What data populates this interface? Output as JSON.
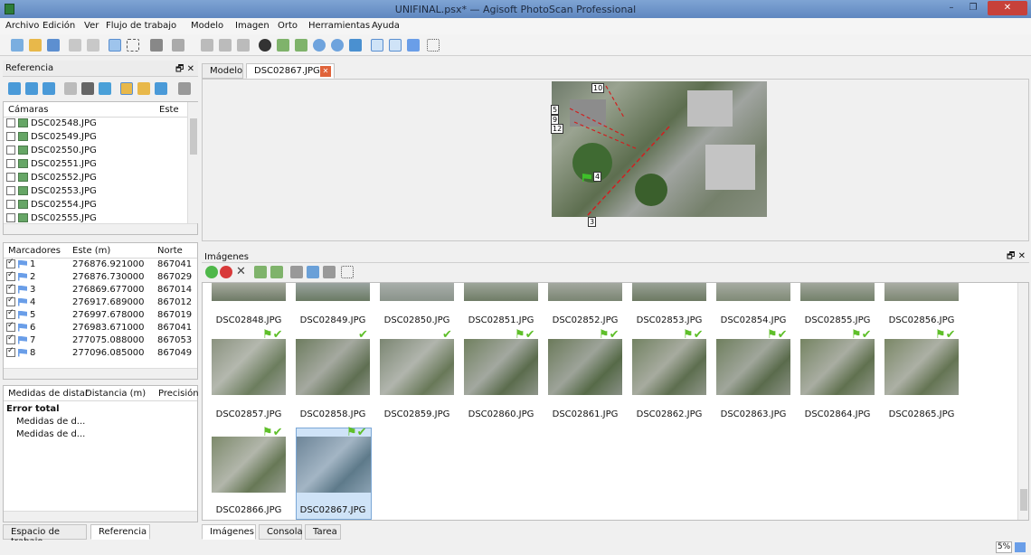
{
  "window": {
    "title": "UNIFINAL.psx* — Agisoft PhotoScan Professional",
    "min": "–",
    "max": "❐",
    "close": "✕"
  },
  "menu": [
    "Archivo",
    "Edición",
    "Ver",
    "Flujo de trabajo",
    "Modelo",
    "Imagen",
    "Orto",
    "Herramientas",
    "Ayuda"
  ],
  "reference": {
    "title": "Referencia",
    "cameras": {
      "col1": "Cámaras",
      "col2": "Este",
      "items": [
        "DSC02548.JPG",
        "DSC02549.JPG",
        "DSC02550.JPG",
        "DSC02551.JPG",
        "DSC02552.JPG",
        "DSC02553.JPG",
        "DSC02554.JPG",
        "DSC02555.JPG"
      ]
    },
    "markers": {
      "col1": "Marcadores",
      "col2": "Este (m)",
      "col3": "Norte",
      "items": [
        {
          "n": "1",
          "este": "276876.921000",
          "norte": "867041"
        },
        {
          "n": "2",
          "este": "276876.730000",
          "norte": "867029"
        },
        {
          "n": "3",
          "este": "276869.677000",
          "norte": "867014"
        },
        {
          "n": "4",
          "este": "276917.689000",
          "norte": "867012"
        },
        {
          "n": "5",
          "este": "276997.678000",
          "norte": "867019"
        },
        {
          "n": "6",
          "este": "276983.671000",
          "norte": "867041"
        },
        {
          "n": "7",
          "este": "277075.088000",
          "norte": "867053"
        },
        {
          "n": "8",
          "este": "277096.085000",
          "norte": "867049"
        }
      ]
    },
    "distances": {
      "col1": "Medidas de distar",
      "col2": "Distancia (m)",
      "col3": "Precisión",
      "group": "Error total",
      "items": [
        "Medidas de d...",
        "Medidas de d..."
      ]
    },
    "bottom_tabs": [
      "Espacio de trabajo",
      "Referencia"
    ]
  },
  "view": {
    "tabs": [
      "Modelo",
      "DSC02867.JPG"
    ],
    "markers": [
      "10",
      "5",
      "9",
      "12",
      "4",
      "3"
    ]
  },
  "images": {
    "title": "Imágenes",
    "row1": [
      "DSC02848.JPG",
      "DSC02849.JPG",
      "DSC02850.JPG",
      "DSC02851.JPG",
      "DSC02852.JPG",
      "DSC02853.JPG",
      "DSC02854.JPG",
      "DSC02855.JPG",
      "DSC02856.JPG"
    ],
    "row2": [
      "DSC02857.JPG",
      "DSC02858.JPG",
      "DSC02859.JPG",
      "DSC02860.JPG",
      "DSC02861.JPG",
      "DSC02862.JPG",
      "DSC02863.JPG",
      "DSC02864.JPG",
      "DSC02865.JPG"
    ],
    "row3": [
      "DSC02866.JPG",
      "DSC02867.JPG"
    ],
    "bottom_tabs": [
      "Imágenes",
      "Consola",
      "Tarea"
    ]
  },
  "status": {
    "zoom": "5%"
  },
  "colors": {
    "titlebar": "#6b92c9",
    "accent": "#5fbf2a",
    "marker": "#6a9ee8",
    "selection": "#cfe3f7"
  }
}
